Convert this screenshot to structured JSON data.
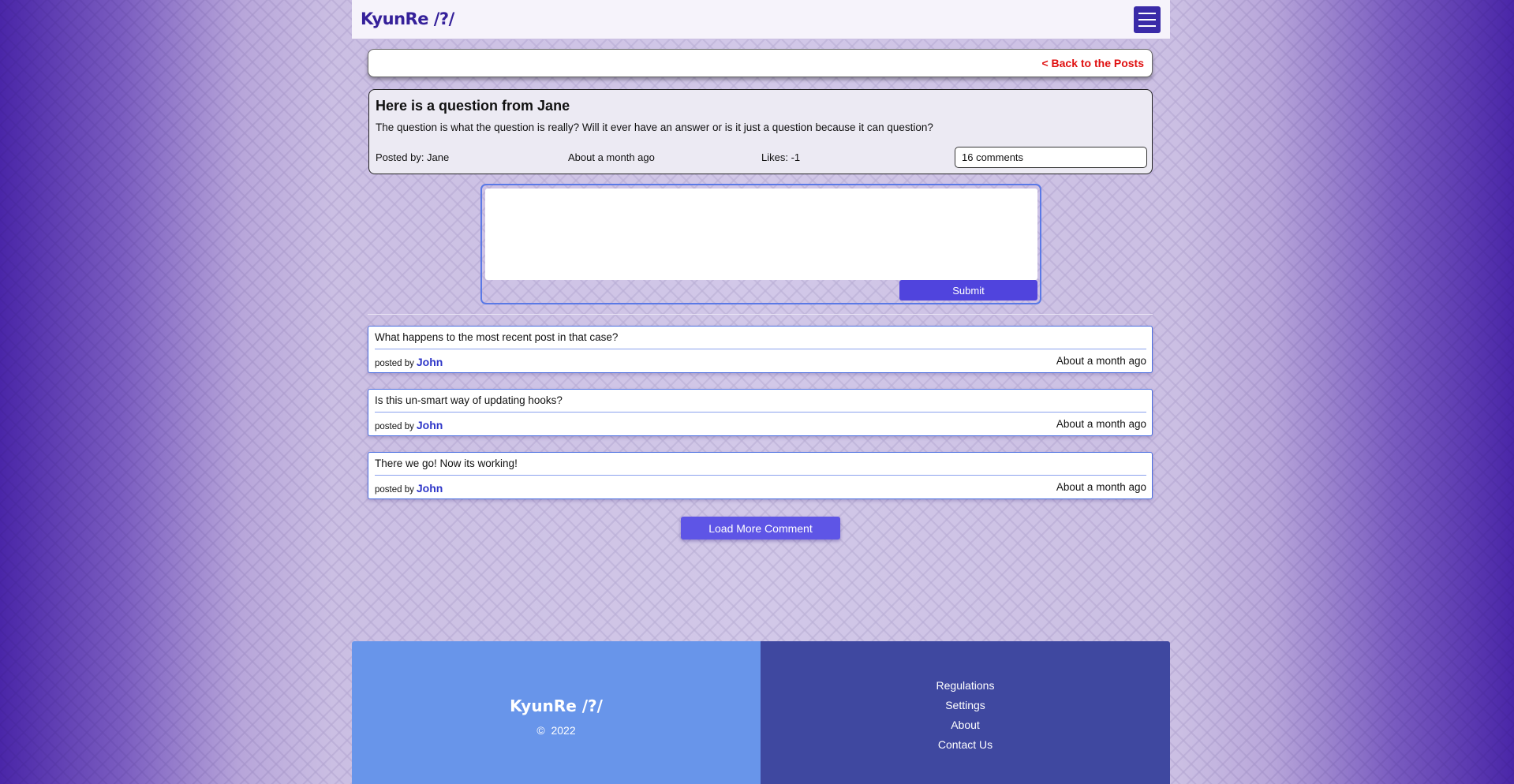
{
  "header": {
    "brand": "KyunRe /?/",
    "menu_icon": "hamburger-icon"
  },
  "nav": {
    "back_label": "< Back to the Posts"
  },
  "post": {
    "title": "Here is a question from Jane",
    "body": "The question is what the question is really? Will it ever have an answer or is it just a question because it can question?",
    "posted_by": "Posted by: Jane",
    "time": "About a month ago",
    "likes": "Likes: -1",
    "comments_count": "16 comments"
  },
  "composer": {
    "value": "",
    "submit_label": "Submit"
  },
  "comments": [
    {
      "text": "What happens to the most recent post in that case?",
      "by_label": "posted by",
      "author": "John",
      "time": "About a month ago"
    },
    {
      "text": "Is this un-smart way of updating hooks?",
      "by_label": "posted by",
      "author": "John",
      "time": "About a month ago"
    },
    {
      "text": "There we go! Now its working!",
      "by_label": "posted by",
      "author": "John",
      "time": "About a month ago"
    }
  ],
  "load_more_label": "Load More Comment",
  "footer": {
    "brand": "KyunRe /?/",
    "copyright_symbol": "©",
    "year": "2022",
    "links": [
      "Regulations",
      "Settings",
      "About",
      "Contact Us"
    ]
  },
  "colors": {
    "brand": "#35209a",
    "accent": "#5044dd",
    "back_link": "#e01010",
    "footer_left": "#6895ea",
    "footer_right": "#3f48a0"
  }
}
